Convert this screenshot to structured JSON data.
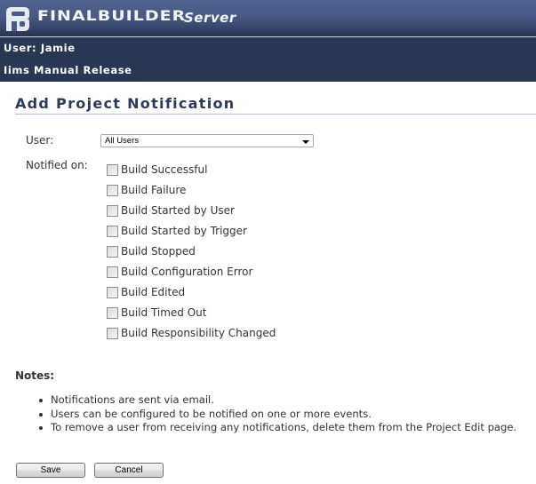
{
  "header": {
    "logo_icon": "finalbuilder-logo-icon",
    "brand": "FINALBUILDER",
    "brand_sub": "Server",
    "user_line": "User: Jamie",
    "project_line": "Iims Manual Release"
  },
  "page": {
    "title": "Add Project Notification"
  },
  "form": {
    "user_label": "User:",
    "user_select": {
      "selected": "All Users",
      "icon": "chevron-down-icon"
    },
    "notified_label": "Notified on:",
    "events": [
      {
        "label": "Build Successful",
        "checked": false
      },
      {
        "label": "Build Failure",
        "checked": false
      },
      {
        "label": "Build Started by User",
        "checked": false
      },
      {
        "label": "Build Started by Trigger",
        "checked": false
      },
      {
        "label": "Build Stopped",
        "checked": false
      },
      {
        "label": "Build Configuration Error",
        "checked": false
      },
      {
        "label": "Build Edited",
        "checked": false
      },
      {
        "label": "Build Timed Out",
        "checked": false
      },
      {
        "label": "Build Responsibility Changed",
        "checked": false
      }
    ]
  },
  "notes": {
    "heading": "Notes:",
    "items": [
      "Notifications are sent via email.",
      "Users can be configured to be notified on one or more events.",
      "To remove a user from receiving any notifications, delete them from the Project Edit page."
    ]
  },
  "actions": {
    "save_label": "Save",
    "cancel_label": "Cancel"
  },
  "colors": {
    "header_top": "#506190",
    "header_bottom": "#2b3350",
    "infobar": "#2a3753",
    "title": "#2b3a55",
    "rule": "#b9c3d1"
  }
}
